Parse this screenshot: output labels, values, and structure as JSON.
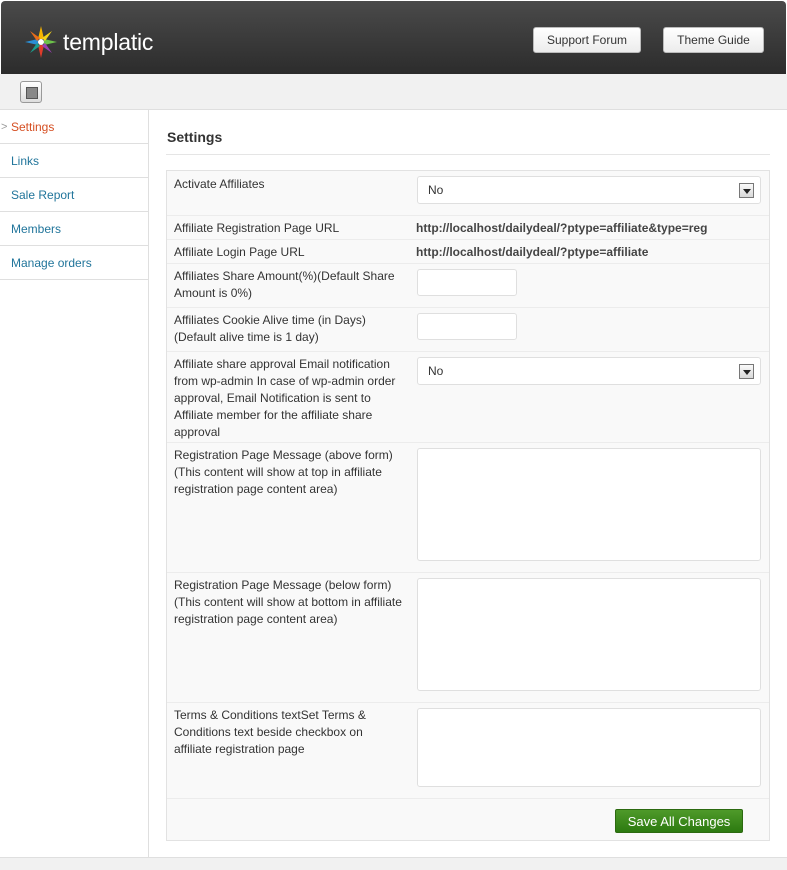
{
  "header": {
    "logo_text": "templatic",
    "support_label": "Support Forum",
    "theme_label": "Theme Guide"
  },
  "sidebar": {
    "items": [
      {
        "label": "Settings",
        "active": true
      },
      {
        "label": "Links"
      },
      {
        "label": "Sale Report"
      },
      {
        "label": "Members"
      },
      {
        "label": "Manage orders"
      }
    ]
  },
  "main": {
    "title": "Settings",
    "fields": {
      "activate": {
        "label": "Activate Affiliates",
        "value": "No"
      },
      "reg_url": {
        "label": "Affiliate Registration Page URL",
        "value": "http://localhost/dailydeal/?ptype=affiliate&type=reg"
      },
      "login_url": {
        "label": "Affiliate Login Page URL",
        "value": "http://localhost/dailydeal/?ptype=affiliate"
      },
      "share_amount": {
        "label": "Affiliates Share Amount(%)(Default Share Amount is 0%)",
        "value": ""
      },
      "cookie": {
        "label": "Affiliates Cookie Alive time (in Days)(Default alive time is 1 day)",
        "value": ""
      },
      "email_notify": {
        "label": "Affiliate share approval Email notification from wp-admin In case of wp-admin order approval, Email Notification is sent to Affiliate member for the affiliate share approval",
        "value": "No"
      },
      "msg_above": {
        "label": "Registration Page Message (above form)(This content will show at top in affiliate registration page content area)",
        "value": ""
      },
      "msg_below": {
        "label": "Registration Page Message (below form)(This content will show at bottom in affiliate registration page content area)",
        "value": ""
      },
      "terms": {
        "label": "Terms & Conditions textSet Terms & Conditions text beside checkbox on affiliate registration page",
        "value": ""
      }
    },
    "save_label": "Save All Changes"
  },
  "colors": {
    "header_bg": "#333333",
    "link": "#21759b",
    "active": "#d54e21",
    "save_button": "#3f8b1e"
  }
}
